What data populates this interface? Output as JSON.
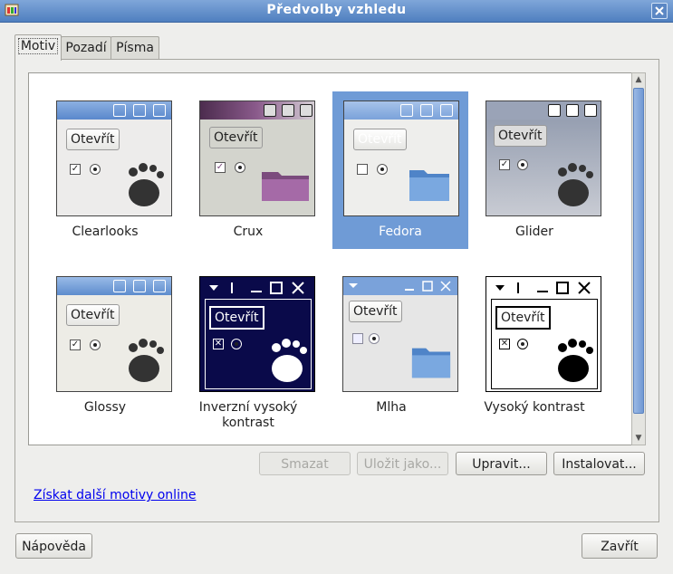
{
  "window": {
    "title": "Předvolby vzhledu"
  },
  "tabs": [
    {
      "label": "Motiv"
    },
    {
      "label": "Pozadí"
    },
    {
      "label": "Písma"
    }
  ],
  "themes": [
    {
      "name": "Clearlooks"
    },
    {
      "name": "Crux"
    },
    {
      "name": "Fedora"
    },
    {
      "name": "Glider"
    },
    {
      "name": "Glossy"
    },
    {
      "name": "Inverzní vysoký kontrast"
    },
    {
      "name": "Mlha"
    },
    {
      "name": "Vysoký kontrast"
    }
  ],
  "preview_button_label": "Otevřít",
  "buttons": {
    "delete": "Smazat",
    "save_as": "Uložit jako...",
    "edit": "Upravit...",
    "install": "Instalovat..."
  },
  "link": "Získat další motivy online",
  "footer": {
    "help": "Nápověda",
    "close": "Zavřít"
  },
  "colors": {
    "selection": "#6f9bd6",
    "titlebar": "#5b87c4"
  }
}
